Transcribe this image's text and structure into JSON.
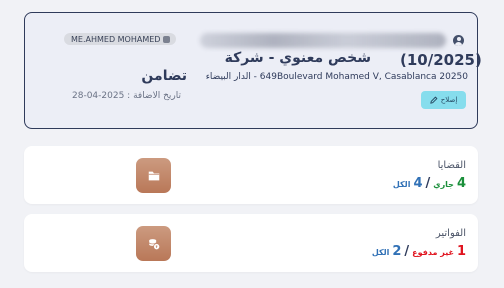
{
  "client": {
    "badge_label": "ME.AHMED MOHAMED",
    "reference": "(10/2025)",
    "entity_line1": "شخص معنوي - شركة",
    "entity_line2": "تضامن",
    "address": "649Boulevard Mohamed V, Casablanca 20250 - الدار البيضاء",
    "date_added": "تاريخ الاضافة : 2025-04-28",
    "edit_label": "إصلاح"
  },
  "cases": {
    "title": "القضايا",
    "active_count": "4",
    "active_label": "جاري",
    "separator": "/",
    "total_count": "4",
    "total_label": "الكل"
  },
  "invoices": {
    "title": "الفواتير",
    "unpaid_count": "1",
    "unpaid_label": "غير مدفوع",
    "separator": "/",
    "total_count": "2",
    "total_label": "الكل"
  },
  "colors": {
    "accent_navy": "#2f3b5b",
    "edit_button_bg": "#86dded",
    "icon_tile": "#c0856a",
    "active_green": "#1a8f3a",
    "total_blue": "#3171b6",
    "unpaid_red": "#e0141f"
  },
  "icons": {
    "badge": "lock-icon",
    "user": "user-circle-icon",
    "edit": "pencil-icon",
    "cases": "folder-icon",
    "invoices": "coins-icon"
  }
}
